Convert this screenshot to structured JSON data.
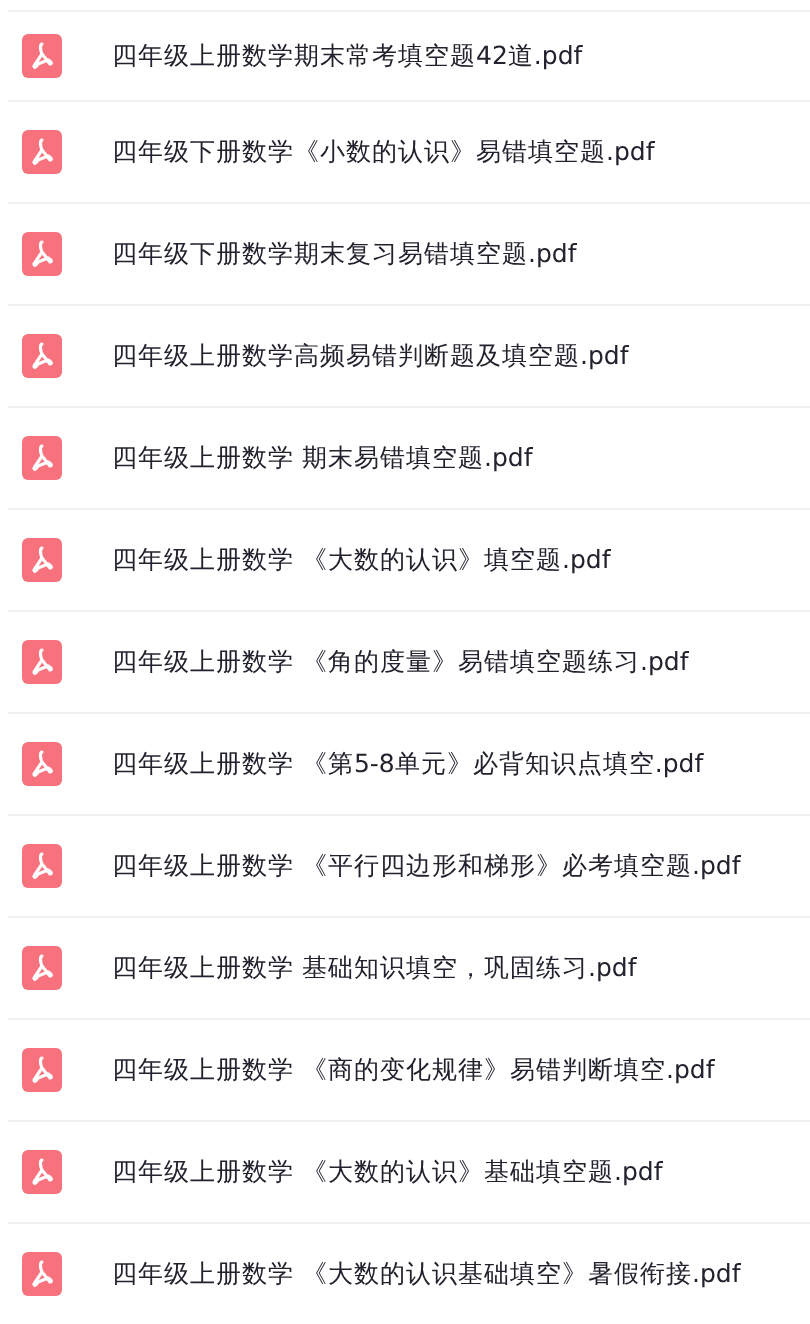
{
  "files": [
    {
      "name": "四年级上册数学期末常考填空题42道.pdf",
      "kind": "pdf"
    },
    {
      "name": "四年级下册数学《小数的认识》易错填空题.pdf",
      "kind": "pdf"
    },
    {
      "name": "四年级下册数学期末复习易错填空题.pdf",
      "kind": "pdf"
    },
    {
      "name": "四年级上册数学高频易错判断题及填空题.pdf",
      "kind": "pdf"
    },
    {
      "name": "四年级上册数学 期末易错填空题.pdf",
      "kind": "pdf"
    },
    {
      "name": "四年级上册数学 《大数的认识》填空题.pdf",
      "kind": "pdf"
    },
    {
      "name": "四年级上册数学 《角的度量》易错填空题练习.pdf",
      "kind": "pdf"
    },
    {
      "name": "四年级上册数学 《第5-8单元》必背知识点填空.pdf",
      "kind": "pdf"
    },
    {
      "name": "四年级上册数学 《平行四边形和梯形》必考填空题.pdf",
      "kind": "pdf"
    },
    {
      "name": "四年级上册数学 基础知识填空，巩固练习.pdf",
      "kind": "pdf"
    },
    {
      "name": "四年级上册数学 《商的变化规律》易错判断填空.pdf",
      "kind": "pdf"
    },
    {
      "name": "四年级上册数学 《大数的认识》基础填空题.pdf",
      "kind": "pdf"
    },
    {
      "name": "四年级上册数学 《大数的认识基础填空》暑假衔接.pdf",
      "kind": "pdf"
    }
  ]
}
